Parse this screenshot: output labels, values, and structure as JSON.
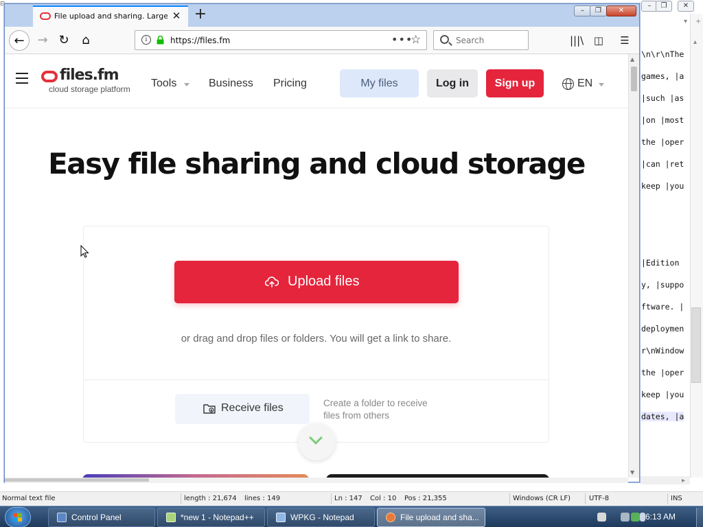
{
  "notepad": {
    "editor_lines": [
      {
        "text": "\\n\\r\\nThe"
      },
      {
        "text": "games, |a"
      },
      {
        "text": "|such |as"
      },
      {
        "text": "|on |most"
      },
      {
        "text": "the |oper"
      },
      {
        "text": "|can |ret"
      },
      {
        "text": "keep |you"
      },
      {
        "text": ""
      },
      {
        "text": ""
      },
      {
        "text": "|Edition"
      },
      {
        "text": "y, |suppo"
      },
      {
        "text": "ftware. |"
      },
      {
        "text": "deploymen"
      },
      {
        "text": "r\\nWindow"
      },
      {
        "text": "the |oper"
      },
      {
        "text": "keep |you"
      },
      {
        "text": "dates, |a"
      }
    ],
    "statusbar": {
      "file_type": "Normal text file",
      "length": "length : 21,674",
      "lines": "lines : 149",
      "ln": "Ln : 147",
      "col": "Col : 10",
      "pos": "Pos : 21,355",
      "eol": "Windows (CR LF)",
      "encoding": "UTF-8",
      "mode": "INS"
    }
  },
  "firefox": {
    "tab_title": "File upload and sharing. Large f",
    "new_tab_glyph": "+",
    "url": "https://files.fm",
    "search_placeholder": "Search"
  },
  "site": {
    "logo_text": "files.fm",
    "logo_tagline": "cloud storage platform",
    "nav": {
      "tools": "Tools",
      "business": "Business",
      "pricing": "Pricing"
    },
    "buttons": {
      "my_files": "My files",
      "log_in": "Log in",
      "sign_up": "Sign up"
    },
    "language": "EN",
    "hero_title": "Easy file sharing and cloud storage",
    "upload_label": "Upload files",
    "drag_text": "or drag and drop files or folders. You will get a link to share.",
    "receive_label": "Receive files",
    "receive_desc": "Create a folder to receive files from others",
    "colors": {
      "brand_red": "#e4253c",
      "my_files_bg": "#dde9fa",
      "chevron_green": "#7fcb7a"
    }
  },
  "taskbar": {
    "items": [
      {
        "label": "Control Panel",
        "active": false
      },
      {
        "label": "*new 1 - Notepad++",
        "active": false
      },
      {
        "label": "WPKG - Notepad",
        "active": false
      },
      {
        "label": "File upload and sha...",
        "active": true
      }
    ],
    "clock": "6:13 AM"
  }
}
